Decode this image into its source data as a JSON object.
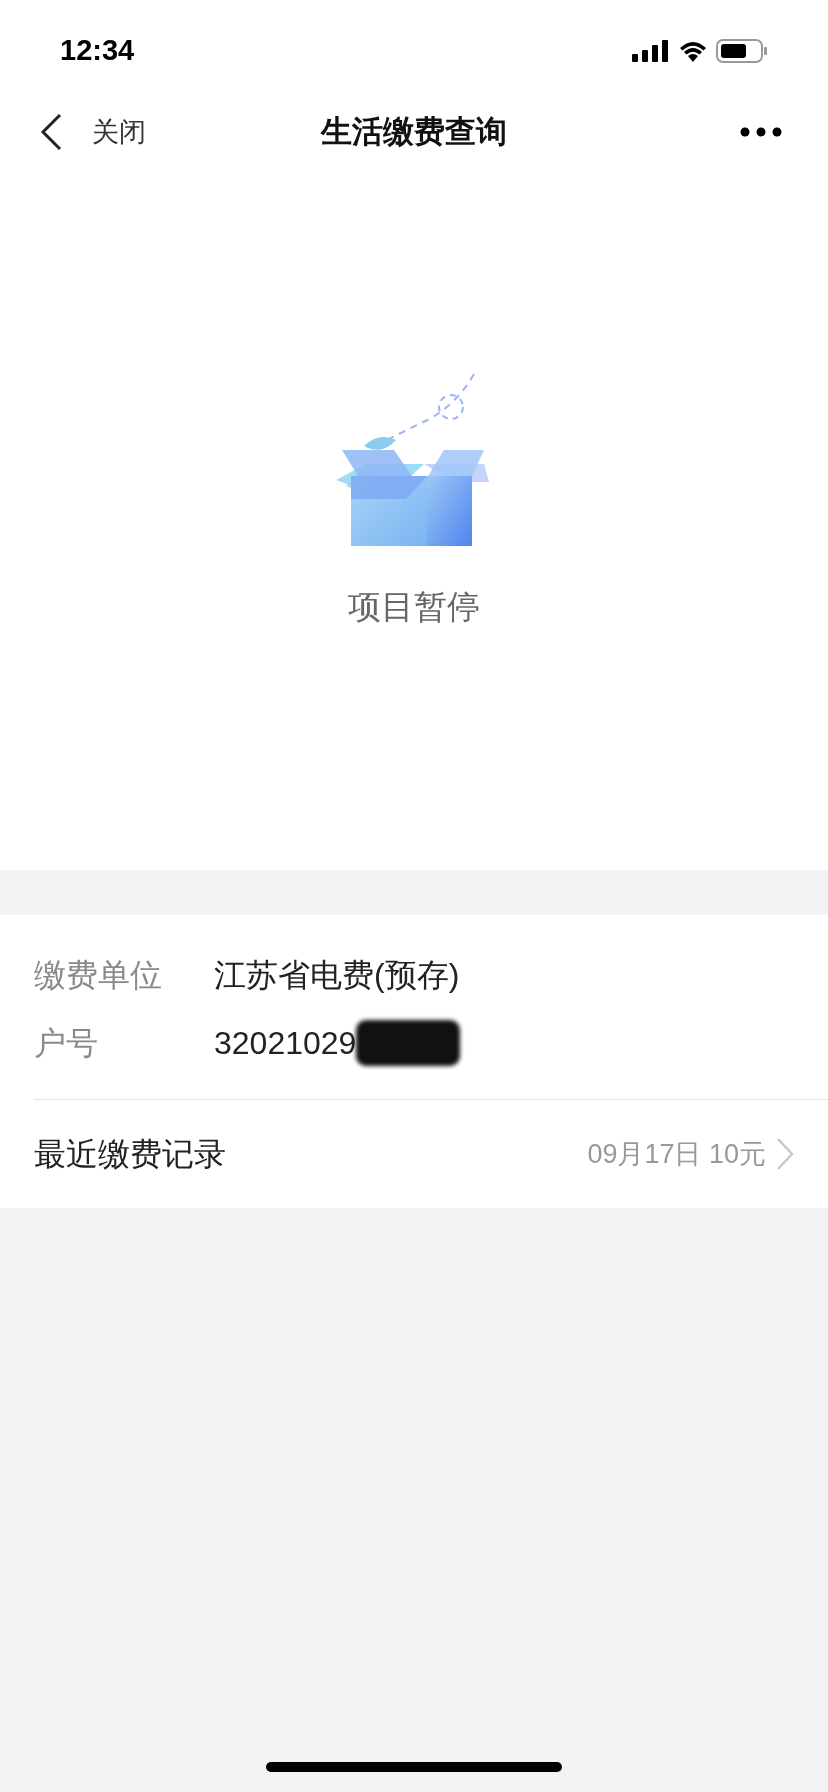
{
  "status_bar": {
    "time": "12:34"
  },
  "nav": {
    "back_label": "关闭",
    "title": "生活缴费查询"
  },
  "empty_state": {
    "message": "项目暂停"
  },
  "info": {
    "rows": [
      {
        "label": "缴费单位",
        "value": "江苏省电费(预存)",
        "redacted": false
      },
      {
        "label": "户号",
        "value": "32021029",
        "redacted": true
      }
    ]
  },
  "recent": {
    "label": "最近缴费记录",
    "value": "09月17日 10元"
  }
}
